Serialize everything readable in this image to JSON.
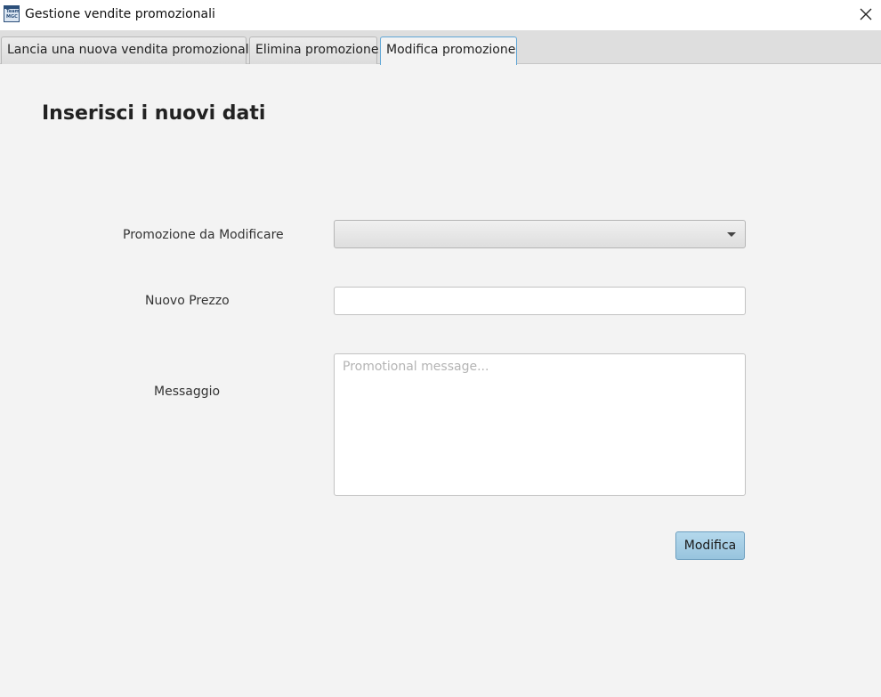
{
  "window": {
    "title": "Gestione vendite promozionali",
    "icon": "app-logo-icon",
    "icon_text_line1": "Team",
    "icon_text_line2": "MGC",
    "close_icon": "close-icon"
  },
  "tabs": [
    {
      "label": "Lancia una nuova vendita promozionale",
      "selected": false
    },
    {
      "label": "Elimina promozione",
      "selected": false
    },
    {
      "label": "Modifica promozione",
      "selected": true
    }
  ],
  "form": {
    "heading": "Inserisci i nuovi dati",
    "promo_label": "Promozione da Modificare",
    "promo_value": "",
    "price_label": "Nuovo Prezzo",
    "price_value": "",
    "message_label": "Messaggio",
    "message_placeholder": "Promotional message...",
    "submit_label": "Modifica"
  },
  "colors": {
    "background": "#f3f3f3",
    "selected_tab_border": "#5fa6d6",
    "button_fill": "#a8d0e6"
  }
}
